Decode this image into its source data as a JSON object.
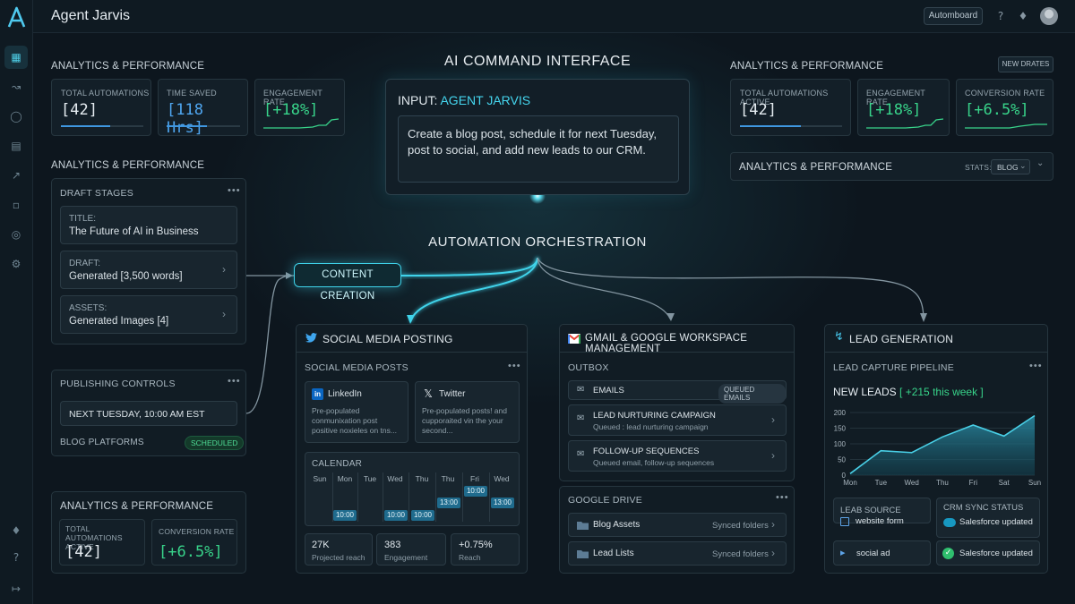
{
  "app": {
    "title": "Agent Jarvis",
    "header_button": "Automboard"
  },
  "left": {
    "sec1_title": "ANALYTICS & PERFORMANCE",
    "metrics": [
      {
        "label": "TOTAL AUTOMATIONS",
        "value": "[42]",
        "progress": 0.6
      },
      {
        "label": "TIME SAVED",
        "value": "[118 Hrs]",
        "progress": 0.55
      },
      {
        "label": "ENGAGEMENT RATE",
        "value": "[+18%]"
      }
    ],
    "sec2_title": "ANALYTICS & PERFORMANCE",
    "draft": {
      "title": "DRAFT STAGES",
      "rows": [
        {
          "label": "TITLE:",
          "text": "The Future of AI in Business"
        },
        {
          "label": "DRAFT:",
          "text": "Generated [3,500 words]"
        },
        {
          "label": "ASSETS:",
          "text": "Generated Images [4]"
        }
      ]
    },
    "publishing": {
      "title": "PUBLISHING CONTROLS",
      "date": "NEXT TUESDAY, 10:00 AM EST",
      "platforms_label": "BLOG PLATFORMS",
      "status": "SCHEDULED"
    },
    "bottom": {
      "title": "ANALYTICS & PERFORMANCE",
      "metrics": [
        {
          "label": "TOTAL AUTOMATIONS ACTIVE",
          "value": "[42]"
        },
        {
          "label": "CONVERSION RATE",
          "value": "[+6.5%]"
        }
      ]
    }
  },
  "command": {
    "title": "AI COMMAND INTERFACE",
    "input_label": "INPUT:",
    "input_agent": "AGENT JARVIS",
    "input_text": "Create a blog post, schedule it for next Tuesday, post to social, and add new leads to our CRM."
  },
  "orchestration": {
    "title": "AUTOMATION ORCHESTRATION",
    "node": "CONTENT CREATION"
  },
  "right": {
    "title": "ANALYTICS & PERFORMANCE",
    "badge": "NEW DRATES",
    "metrics": [
      {
        "label": "TOTAL AUTOMATIONS ACTIVE",
        "value": "[42]",
        "progress": 0.6
      },
      {
        "label": "ENGAGEMENT RATE",
        "value": "[+18%]"
      },
      {
        "label": "CONVERSION RATE",
        "value": "[+6.5%]"
      }
    ],
    "stats_bar": {
      "title": "ANALYTICS & PERFORMANCE",
      "stats_label": "STATS:",
      "select": "BLOG"
    }
  },
  "social": {
    "title": "SOCIAL MEDIA POSTING",
    "posts_title": "SOCIAL MEDIA POSTS",
    "linkedin": {
      "name": "LinkedIn",
      "text": "Pre-populated conmunixation post positive noxieles on tns..."
    },
    "twitter": {
      "name": "Twitter",
      "text": "Pre-populated posts! and cupporaited vin the your second..."
    },
    "calendar": {
      "title": "CALENDAR",
      "days": [
        "Sun",
        "Mon",
        "Tue",
        "Wed",
        "Thu",
        "Thu",
        "Fri",
        "Wed"
      ],
      "times": [
        "10:00",
        "10:00",
        "10:00",
        "13:00",
        "10:00",
        "13:00"
      ]
    },
    "stats": [
      {
        "value": "27K",
        "label": "Projected reach"
      },
      {
        "value": "383",
        "label": "Engagement"
      },
      {
        "value": "+0.75%",
        "label": "Reach"
      }
    ]
  },
  "gmail": {
    "title": "GMAIL & GOOGLE WORKSPACE MANAGEMENT",
    "outbox_title": "OUTBOX",
    "emails_label": "EMAILS",
    "emails_badge": "QUEUED EMAILS",
    "items": [
      {
        "title": "LEAD NURTURING CAMPAIGN",
        "sub": "Queued : lead nurturing campaign"
      },
      {
        "title": "FOLLOW-UP SEQUENCES",
        "sub": "Queued email, follow-up sequences"
      }
    ],
    "drive_title": "GOOGLE DRIVE",
    "drive": [
      {
        "name": "Blog Assets",
        "status": "Synced folders"
      },
      {
        "name": "Lead Lists",
        "status": "Synced folders"
      }
    ]
  },
  "leads": {
    "title": "LEAD GENERATION",
    "pipeline_title": "LEAD CAPTURE PIPELINE",
    "new_leads": "NEW LEADS",
    "new_leads_delta": "[ +215 this week ]",
    "source_title": "LEAB SOURCE",
    "sources": [
      "website form",
      "social ad"
    ],
    "crm_title": "CRM SYNC STATUS",
    "crm": [
      "Salesforce updated",
      "Salesforce updated"
    ]
  },
  "chart_data": {
    "type": "area",
    "categories": [
      "Mon",
      "Tue",
      "Wed",
      "Thu",
      "Fri",
      "Sat",
      "Sun"
    ],
    "values": [
      5,
      78,
      72,
      122,
      160,
      125,
      190
    ],
    "ylim": [
      0,
      200
    ],
    "yticks": [
      "200",
      "150",
      "100",
      "50",
      "0"
    ],
    "title": "",
    "xlabel": "",
    "ylabel": ""
  }
}
